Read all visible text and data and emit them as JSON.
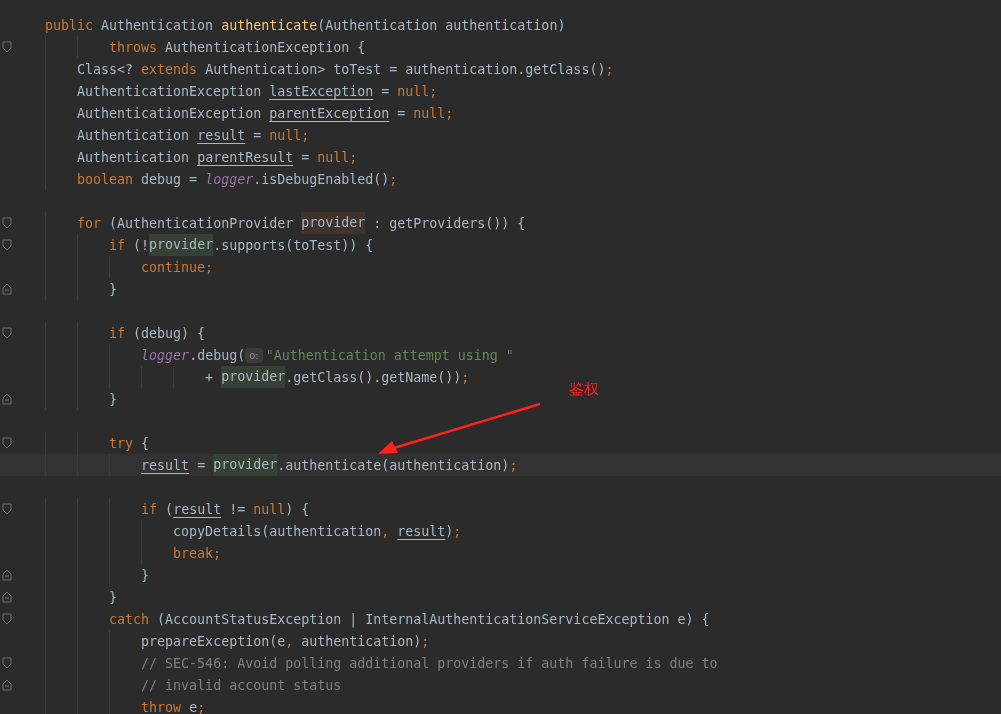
{
  "editor": {
    "lines": [
      {
        "tokens": [
          {
            "text": "public ",
            "kind": "keyword"
          },
          {
            "text": "Authentication ",
            "kind": "plain"
          },
          {
            "text": "authenticate",
            "kind": "method"
          },
          {
            "text": "(Authentication authentication)",
            "kind": "plain"
          }
        ]
      },
      {
        "fold_start": true,
        "tokens": [
          {
            "text": "        throws ",
            "kind": "keyword"
          },
          {
            "text": "AuthenticationException {",
            "kind": "plain"
          }
        ]
      },
      {
        "tokens": [
          {
            "text": "    Class<? ",
            "kind": "plain"
          },
          {
            "text": "extends ",
            "kind": "keyword"
          },
          {
            "text": "Authentication> toTest = authentication.getClass()",
            "kind": "plain"
          },
          {
            "text": ";",
            "kind": "keyword"
          }
        ]
      },
      {
        "tokens": [
          {
            "text": "    AuthenticationException ",
            "kind": "plain"
          },
          {
            "text": "lastException",
            "kind": "reassigned"
          },
          {
            "text": " = ",
            "kind": "plain"
          },
          {
            "text": "null;",
            "kind": "keyword"
          }
        ]
      },
      {
        "tokens": [
          {
            "text": "    AuthenticationException ",
            "kind": "plain"
          },
          {
            "text": "parentException",
            "kind": "reassigned"
          },
          {
            "text": " = ",
            "kind": "plain"
          },
          {
            "text": "null;",
            "kind": "keyword"
          }
        ]
      },
      {
        "tokens": [
          {
            "text": "    Authentication ",
            "kind": "plain"
          },
          {
            "text": "result",
            "kind": "reassigned"
          },
          {
            "text": " = ",
            "kind": "plain"
          },
          {
            "text": "null;",
            "kind": "keyword"
          }
        ]
      },
      {
        "tokens": [
          {
            "text": "    Authentication ",
            "kind": "plain"
          },
          {
            "text": "parentResult",
            "kind": "reassigned"
          },
          {
            "text": " = ",
            "kind": "plain"
          },
          {
            "text": "null;",
            "kind": "keyword"
          }
        ]
      },
      {
        "tokens": [
          {
            "text": "    boolean ",
            "kind": "keyword"
          },
          {
            "text": "debug = ",
            "kind": "plain"
          },
          {
            "text": "logger",
            "kind": "static"
          },
          {
            "text": ".isDebugEnabled()",
            "kind": "plain"
          },
          {
            "text": ";",
            "kind": "keyword"
          }
        ]
      },
      {
        "gap_before": true,
        "fold_start": true,
        "tokens": [
          {
            "text": "    for ",
            "kind": "keyword"
          },
          {
            "text": "(AuthenticationProvider ",
            "kind": "plain"
          },
          {
            "text": "provider",
            "kind": "declaration"
          },
          {
            "text": " : getProviders()) {",
            "kind": "plain"
          }
        ]
      },
      {
        "fold_start": true,
        "tokens": [
          {
            "text": "        if ",
            "kind": "keyword"
          },
          {
            "text": "(!",
            "kind": "plain"
          },
          {
            "text": "provider",
            "kind": "usage"
          },
          {
            "text": ".supports(toTest)) {",
            "kind": "plain"
          }
        ]
      },
      {
        "tokens": [
          {
            "text": "            continue;",
            "kind": "keyword"
          }
        ]
      },
      {
        "fold_end": true,
        "tokens": [
          {
            "text": "        }",
            "kind": "plain"
          }
        ]
      },
      {
        "gap_before": true,
        "fold_start": true,
        "tokens": [
          {
            "text": "        if ",
            "kind": "keyword"
          },
          {
            "text": "(debug) {",
            "kind": "plain"
          }
        ]
      },
      {
        "tokens": [
          {
            "text": "            logger",
            "kind": "static"
          },
          {
            "text": ".debug(",
            "kind": "plain"
          },
          {
            "text": "o:",
            "kind": "hint"
          },
          {
            "text": "\"Authentication attempt using \"",
            "kind": "string"
          }
        ]
      },
      {
        "tokens": [
          {
            "text": "                    + ",
            "kind": "plain"
          },
          {
            "text": "provider",
            "kind": "usage"
          },
          {
            "text": ".getClass().getName())",
            "kind": "plain"
          },
          {
            "text": ";",
            "kind": "keyword"
          }
        ]
      },
      {
        "fold_end": true,
        "tokens": [
          {
            "text": "        }",
            "kind": "plain"
          }
        ]
      },
      {
        "gap_before": true,
        "fold_start": true,
        "tokens": [
          {
            "text": "        try ",
            "kind": "keyword"
          },
          {
            "text": "{",
            "kind": "plain"
          }
        ]
      },
      {
        "current": true,
        "tokens": [
          {
            "text": "            result",
            "kind": "reassigned"
          },
          {
            "text": " = ",
            "kind": "plain"
          },
          {
            "text": "provider",
            "kind": "usage"
          },
          {
            "text": ".authenticate(authentication)",
            "kind": "plain"
          },
          {
            "text": ";",
            "kind": "keyword"
          }
        ]
      },
      {
        "gap_before": true,
        "fold_start": true,
        "tokens": [
          {
            "text": "            if ",
            "kind": "keyword"
          },
          {
            "text": "(",
            "kind": "plain"
          },
          {
            "text": "result",
            "kind": "reassigned"
          },
          {
            "text": " != ",
            "kind": "plain"
          },
          {
            "text": "null",
            "kind": "keyword"
          },
          {
            "text": ") {",
            "kind": "plain"
          }
        ]
      },
      {
        "tokens": [
          {
            "text": "                copyDetails(authentication",
            "kind": "plain"
          },
          {
            "text": ", ",
            "kind": "keyword"
          },
          {
            "text": "result",
            "kind": "reassigned"
          },
          {
            "text": ")",
            "kind": "plain"
          },
          {
            "text": ";",
            "kind": "keyword"
          }
        ]
      },
      {
        "tokens": [
          {
            "text": "                break;",
            "kind": "keyword"
          }
        ]
      },
      {
        "fold_end": true,
        "tokens": [
          {
            "text": "            }",
            "kind": "plain"
          }
        ]
      },
      {
        "fold_end": true,
        "tokens": [
          {
            "text": "        }",
            "kind": "plain"
          }
        ]
      },
      {
        "fold_start": true,
        "tokens": [
          {
            "text": "        catch ",
            "kind": "keyword"
          },
          {
            "text": "(AccountStatusException | InternalAuthenticationServiceException e) {",
            "kind": "plain"
          }
        ]
      },
      {
        "tokens": [
          {
            "text": "            prepareException(e",
            "kind": "plain"
          },
          {
            "text": ", ",
            "kind": "keyword"
          },
          {
            "text": "authentication)",
            "kind": "plain"
          },
          {
            "text": ";",
            "kind": "keyword"
          }
        ]
      },
      {
        "fold_start": true,
        "tokens": [
          {
            "text": "            // SEC-546: Avoid polling additional providers if auth failure is due to",
            "kind": "comment"
          }
        ]
      },
      {
        "fold_end": true,
        "tokens": [
          {
            "text": "            // invalid account status",
            "kind": "comment"
          }
        ]
      },
      {
        "tokens": [
          {
            "text": "            throw ",
            "kind": "keyword"
          },
          {
            "text": "e",
            "kind": "plain"
          },
          {
            "text": ";",
            "kind": "keyword"
          }
        ]
      }
    ]
  },
  "annotation": {
    "label": "鉴权"
  }
}
